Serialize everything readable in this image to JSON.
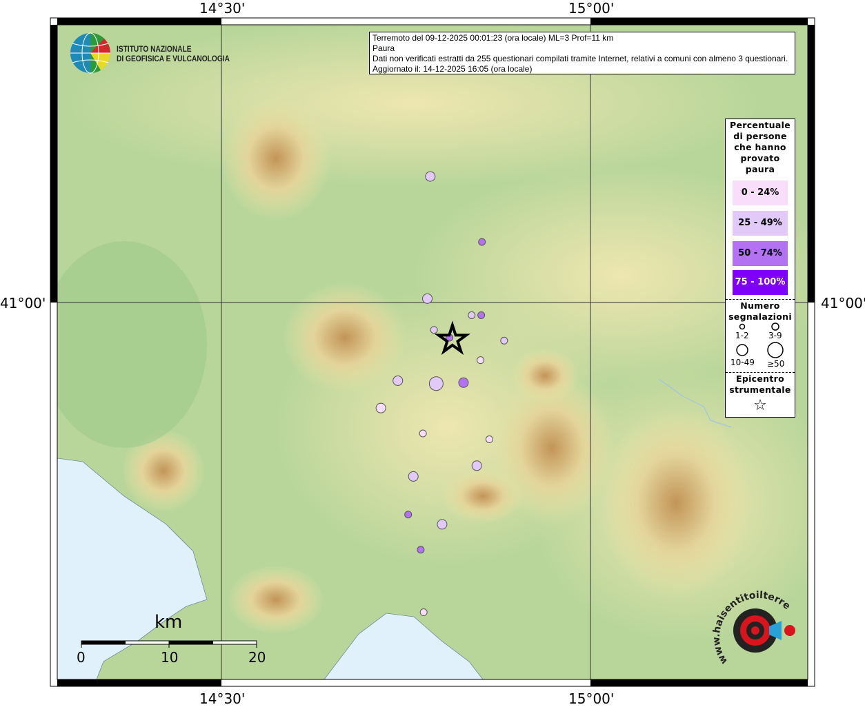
{
  "map": {
    "lon_ticks": [
      "14°30'",
      "15°00'"
    ],
    "lat_ticks": [
      "41°00'"
    ],
    "colors": {
      "sea": "#e1f1fb",
      "land_low": "#9cc98b",
      "land_mid": "#e8e3a6",
      "land_high": "#c09050"
    }
  },
  "logo": {
    "institute_line1": "ISTITUTO NAZIONALE",
    "institute_line2": "DI GEOFISICA E VULCANOLOGIA",
    "site_logo": "www.haisentitoilterremoto.it"
  },
  "info": {
    "line1": "Terremoto del 09-12-2025 00:01:23 (ora locale) ML=3 Prof=11 km",
    "line2": "Paura",
    "line3": "Dati non verificati estratti da 255 questionari compilati tramite Internet, relativi a comuni con almeno 3 questionari.",
    "line4": "Aggiornato il: 14-12-2025 16:05 (ora locale)"
  },
  "legend": {
    "title": [
      "Percentuale",
      "di persone",
      "che hanno",
      "provato",
      "paura"
    ],
    "classes": [
      {
        "label": "0 - 24%",
        "color": "#f9defc",
        "text": "#000"
      },
      {
        "label": "25 - 49%",
        "color": "#e2caf8",
        "text": "#000"
      },
      {
        "label": "50 - 74%",
        "color": "#b272f2",
        "text": "#000"
      },
      {
        "label": "75 - 100%",
        "color": "#7f00f8",
        "text": "#fff"
      }
    ],
    "count_title": [
      "Numero",
      "segnalazioni"
    ],
    "count_classes": [
      "1-2",
      "3-9",
      "10-49",
      "≥50"
    ],
    "epicenter_title": [
      "Epicentro",
      "strumentale"
    ]
  },
  "scale_bar": {
    "unit": "km",
    "labels": [
      "0",
      "10",
      "20"
    ]
  },
  "epicenter": {
    "lon": 14.813,
    "lat": 40.962
  },
  "points": [
    {
      "lon": 14.783,
      "lat": 41.129,
      "fear": 1,
      "count": 1
    },
    {
      "lon": 14.853,
      "lat": 41.062,
      "fear": 2,
      "count": 0
    },
    {
      "lon": 14.779,
      "lat": 41.004,
      "fear": 1,
      "count": 1
    },
    {
      "lon": 14.839,
      "lat": 40.987,
      "fear": 1,
      "count": 0
    },
    {
      "lon": 14.852,
      "lat": 40.987,
      "fear": 2,
      "count": 0
    },
    {
      "lon": 14.788,
      "lat": 40.972,
      "fear": 1,
      "count": 0
    },
    {
      "lon": 14.809,
      "lat": 40.964,
      "fear": 2,
      "count": 0
    },
    {
      "lon": 14.883,
      "lat": 40.961,
      "fear": 1,
      "count": 0
    },
    {
      "lon": 14.851,
      "lat": 40.941,
      "fear": 0,
      "count": 0
    },
    {
      "lon": 14.739,
      "lat": 40.92,
      "fear": 1,
      "count": 1
    },
    {
      "lon": 14.791,
      "lat": 40.917,
      "fear": 1,
      "count": 2
    },
    {
      "lon": 14.828,
      "lat": 40.918,
      "fear": 2,
      "count": 1
    },
    {
      "lon": 14.716,
      "lat": 40.892,
      "fear": 0,
      "count": 1
    },
    {
      "lon": 14.773,
      "lat": 40.866,
      "fear": 0,
      "count": 0
    },
    {
      "lon": 14.863,
      "lat": 40.86,
      "fear": 0,
      "count": 0
    },
    {
      "lon": 14.846,
      "lat": 40.833,
      "fear": 1,
      "count": 1
    },
    {
      "lon": 14.76,
      "lat": 40.822,
      "fear": 1,
      "count": 1
    },
    {
      "lon": 14.753,
      "lat": 40.783,
      "fear": 2,
      "count": 0
    },
    {
      "lon": 14.799,
      "lat": 40.773,
      "fear": 1,
      "count": 1
    },
    {
      "lon": 14.77,
      "lat": 40.747,
      "fear": 2,
      "count": 0
    },
    {
      "lon": 14.774,
      "lat": 40.683,
      "fear": 0,
      "count": 0
    }
  ]
}
